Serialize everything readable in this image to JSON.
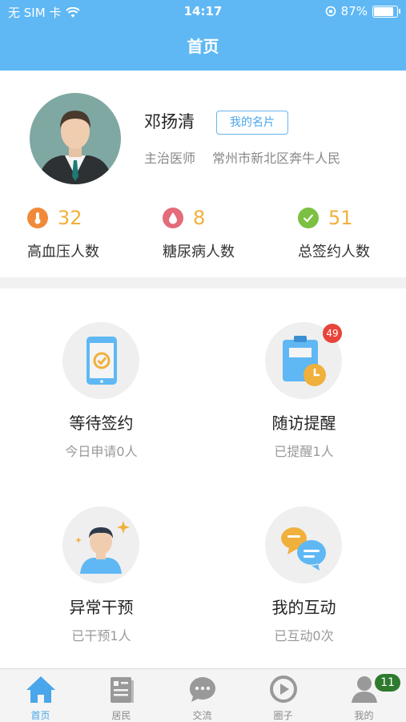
{
  "status_bar": {
    "carrier": "无 SIM 卡",
    "time": "14:17",
    "battery": "87%",
    "battery_level": 0.87
  },
  "nav": {
    "title": "首页"
  },
  "profile": {
    "name": "邓扬清",
    "card_button": "我的名片",
    "title": "主治医师",
    "hospital": "常州市新北区奔牛人民"
  },
  "stats": [
    {
      "value": "32",
      "label": "高血压人数",
      "icon": "thermometer-icon",
      "color": "#f08a3a"
    },
    {
      "value": "8",
      "label": "糖尿病人数",
      "icon": "blood-drop-icon",
      "color": "#e46b7a"
    },
    {
      "value": "51",
      "label": "总签约人数",
      "icon": "check-circle-icon",
      "color": "#7bc043"
    }
  ],
  "tiles": [
    {
      "title": "等待签约",
      "subtitle": "今日申请0人",
      "icon": "tablet-check-icon"
    },
    {
      "title": "随访提醒",
      "subtitle": "已提醒1人",
      "icon": "clipboard-clock-icon",
      "badge": "49"
    },
    {
      "title": "异常干预",
      "subtitle": "已干预1人",
      "icon": "person-sparkle-icon"
    },
    {
      "title": "我的互动",
      "subtitle": "已互动0次",
      "icon": "chat-bubbles-icon"
    }
  ],
  "tabbar": {
    "items": [
      {
        "label": "首页",
        "icon": "home-icon",
        "active": true
      },
      {
        "label": "居民",
        "icon": "residents-icon"
      },
      {
        "label": "交流",
        "icon": "chat-icon"
      },
      {
        "label": "圈子",
        "icon": "circle-icon"
      },
      {
        "label": "我的",
        "icon": "profile-icon",
        "badge": "11"
      }
    ]
  },
  "colors": {
    "primary": "#5fb8f4",
    "accent_number": "#f0b03c",
    "badge_red": "#e8443a",
    "badge_green": "#2f7a2f"
  }
}
